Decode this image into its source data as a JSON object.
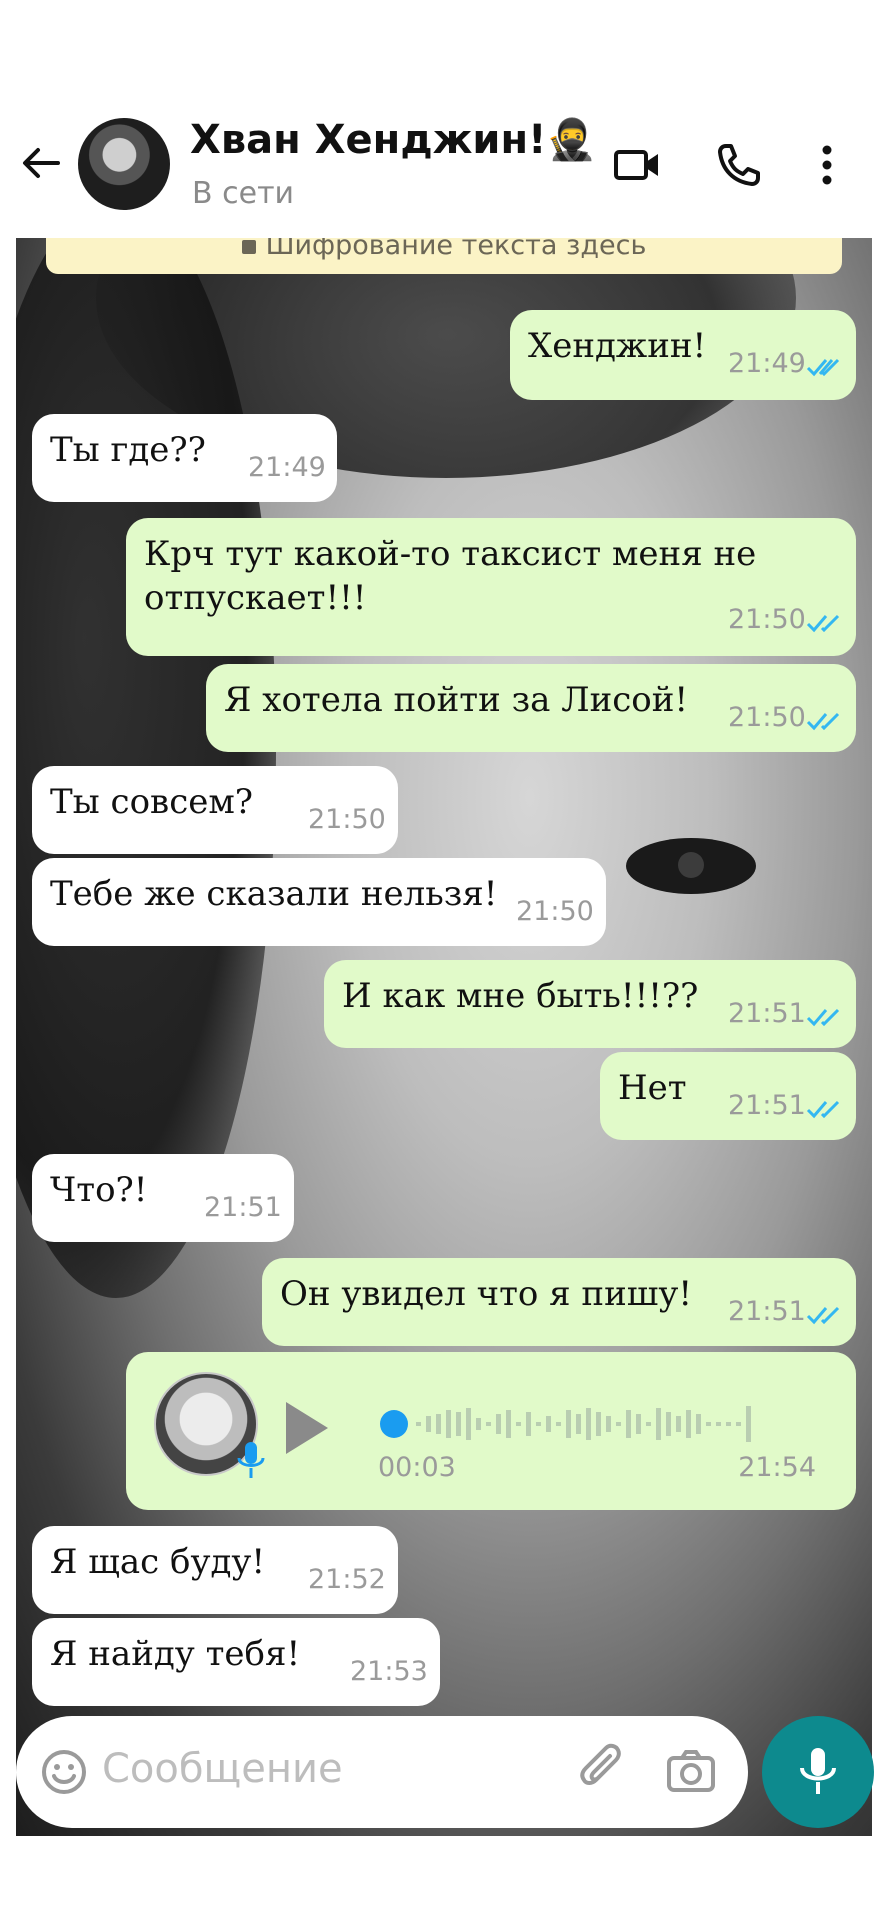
{
  "header": {
    "title": "Хван Хенджин!",
    "status": "В сети",
    "emoji": "🥷"
  },
  "encryption_banner": "Шифрование текста здесь",
  "messages": [
    {
      "dir": "out",
      "text": "Хенджин!",
      "time": "21:49",
      "read": true
    },
    {
      "dir": "in",
      "text": "Ты где??",
      "time": "21:49"
    },
    {
      "dir": "out",
      "text_line1": "Крч тут какой-то таксист меня не",
      "text_line2": "отпускает!!!",
      "time": "21:50",
      "read": true
    },
    {
      "dir": "out",
      "text": "Я хотела пойти за Лисой!",
      "time": "21:50",
      "read": true
    },
    {
      "dir": "in",
      "text": "Ты совсем?",
      "time": "21:50"
    },
    {
      "dir": "in",
      "text": "Тебе же сказали нельзя!",
      "time": "21:50"
    },
    {
      "dir": "out",
      "text": "И как мне быть!!!??",
      "time": "21:51",
      "read": true
    },
    {
      "dir": "out",
      "text": "Нет",
      "time": "21:51",
      "read": true
    },
    {
      "dir": "in",
      "text": "Что?!",
      "time": "21:51"
    },
    {
      "dir": "out",
      "text": "Он увидел что я пишу!",
      "time": "21:51",
      "read": true
    },
    {
      "dir": "out",
      "type": "voice",
      "duration": "00:03",
      "time": "21:54"
    },
    {
      "dir": "in",
      "text": "Я щас буду!",
      "time": "21:52"
    },
    {
      "dir": "in",
      "text": "Я найду тебя!",
      "time": "21:53"
    }
  ],
  "composer": {
    "placeholder": "Сообщение"
  },
  "colors": {
    "outgoing_bubble": "#e1fac9",
    "incoming_bubble": "#ffffff",
    "read_ticks": "#34b7f1",
    "mic_button": "#0d8a8e",
    "voice_progress": "#1a9cf0"
  },
  "icons": [
    "back-arrow-icon",
    "video-call-icon",
    "phone-icon",
    "more-vert-icon",
    "emoji-icon",
    "attach-icon",
    "camera-icon",
    "mic-icon",
    "play-icon",
    "lock-icon",
    "double-check-icon"
  ]
}
